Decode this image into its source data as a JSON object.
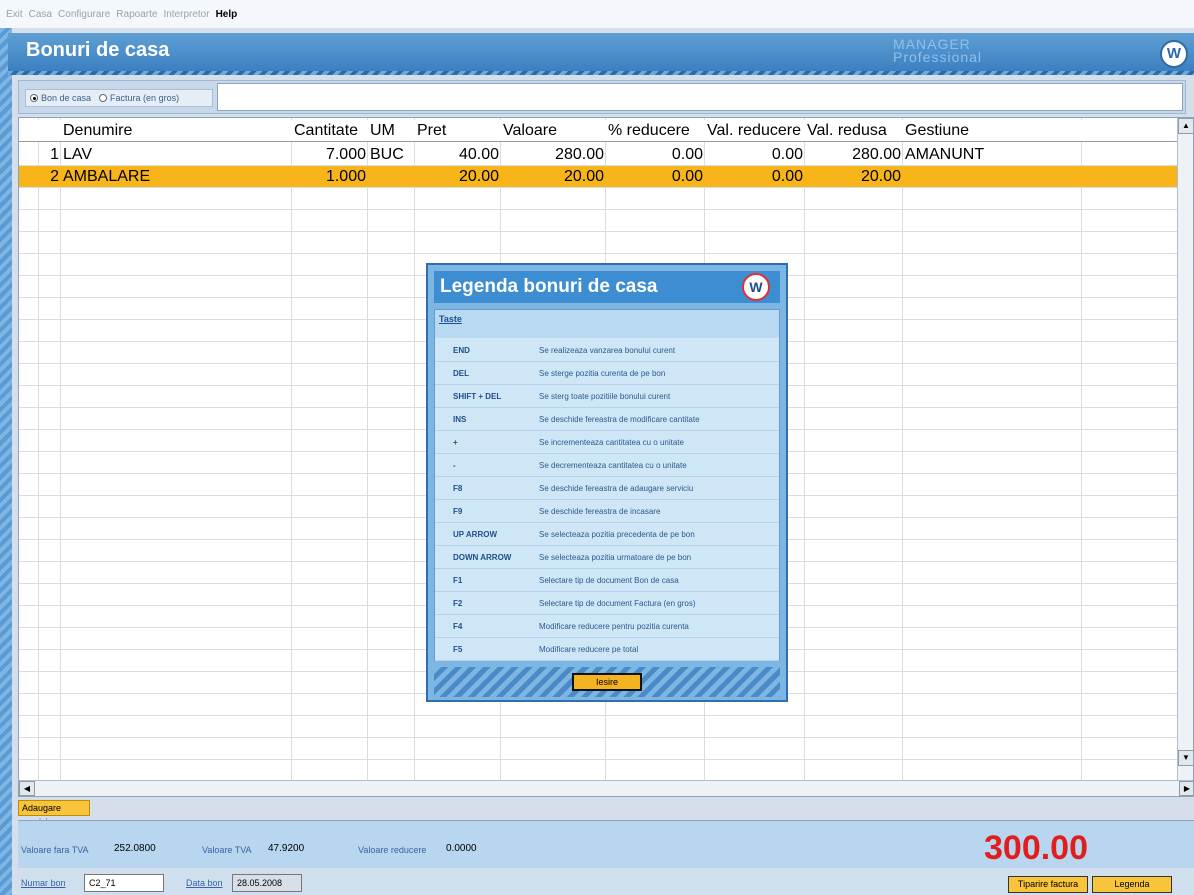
{
  "menu": [
    "Exit",
    "Casa",
    "Configurare",
    "Rapoarte",
    "Interpretor",
    "Help"
  ],
  "window": {
    "title": "Bonuri de casa",
    "brand_line1": "MANAGER",
    "brand_line2": "Professional",
    "logo": "W"
  },
  "doctype": {
    "option1": "Bon de casa",
    "option2": "Factura (en gros)",
    "selected": "Bon de casa"
  },
  "grid": {
    "headers": [
      "Denumire",
      "Cantitate",
      "UM",
      "Pret",
      "Valoare",
      "% reducere",
      "Val. reducere",
      "Val. redusa",
      "Gestiune"
    ],
    "rows": [
      {
        "nr": "1",
        "denumire": "LAV",
        "cantitate": "7.000",
        "um": "BUC",
        "pret": "40.00",
        "valoare": "280.00",
        "reducere_pct": "0.00",
        "val_reducere": "0.00",
        "val_redusa": "280.00",
        "gestiune": "AMANUNT"
      },
      {
        "nr": "2",
        "denumire": "AMBALARE",
        "cantitate": "1.000",
        "um": "",
        "pret": "20.00",
        "valoare": "20.00",
        "reducere_pct": "0.00",
        "val_reducere": "0.00",
        "val_redusa": "20.00",
        "gestiune": ""
      }
    ]
  },
  "legend": {
    "title": "Legenda bonuri de casa",
    "header": "Taste",
    "items": [
      {
        "key": "END",
        "desc": "Se realizeaza vanzarea bonului curent"
      },
      {
        "key": "DEL",
        "desc": "Se sterge pozitia curenta de pe bon"
      },
      {
        "key": "SHIFT + DEL",
        "desc": "Se sterg toate pozitiile bonului curent"
      },
      {
        "key": "INS",
        "desc": "Se deschide fereastra de modificare cantitate"
      },
      {
        "key": "+",
        "desc": "Se incrementeaza cantitatea cu o unitate"
      },
      {
        "key": "-",
        "desc": "Se decrementeaza cantitatea cu o unitate"
      },
      {
        "key": "F8",
        "desc": "Se deschide fereastra de adaugare serviciu"
      },
      {
        "key": "F9",
        "desc": "Se deschide fereastra de incasare"
      },
      {
        "key": "UP ARROW",
        "desc": "Se selecteaza pozitia precedenta de pe bon"
      },
      {
        "key": "DOWN ARROW",
        "desc": "Se selecteaza pozitia urmatoare de pe bon"
      },
      {
        "key": "F1",
        "desc": "Selectare tip de document Bon de casa"
      },
      {
        "key": "F2",
        "desc": "Selectare tip de document Factura (en gros)"
      },
      {
        "key": "F4",
        "desc": "Modificare reducere pentru pozitia curenta"
      },
      {
        "key": "F5",
        "desc": "Modificare reducere pe total"
      }
    ],
    "close_label": "Iesire"
  },
  "bottom": {
    "add_service": "Adaugare serviciu",
    "val_fara_tva_label": "Valoare fara TVA",
    "val_fara_tva": "252.0800",
    "val_tva_label": "Valoare TVA",
    "val_tva": "47.9200",
    "val_reducere_label": "Valoare reducere",
    "val_reducere": "0.0000",
    "total": "300.00",
    "numar_bon_label": "Numar bon",
    "numar_bon": "C2_71",
    "data_bon_label": "Data bon",
    "data_bon": "28.05.2008",
    "print_invoice": "Tiparire factura",
    "legend_button": "Legenda"
  }
}
